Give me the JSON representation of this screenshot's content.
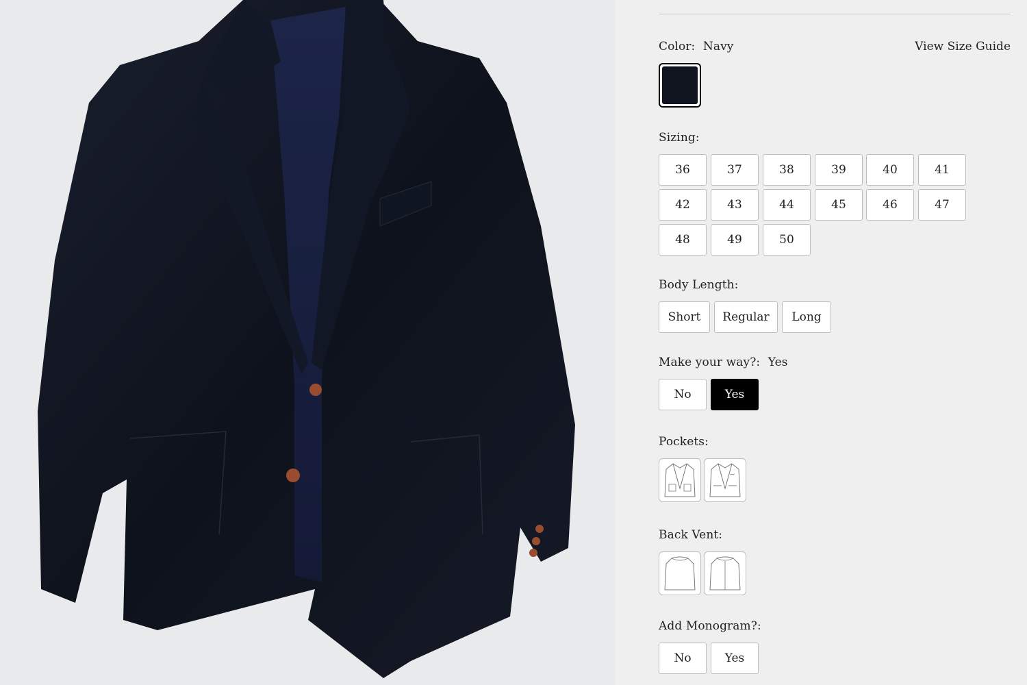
{
  "product_image": {
    "alt": "navy-sport-coat-photo"
  },
  "color": {
    "label": "Color:",
    "value": "Navy",
    "swatch_hex": "#10141e"
  },
  "size_guide": {
    "label": "View Size Guide"
  },
  "sizing": {
    "label": "Sizing:",
    "options": [
      "36",
      "37",
      "38",
      "39",
      "40",
      "41",
      "42",
      "43",
      "44",
      "45",
      "46",
      "47",
      "48",
      "49",
      "50"
    ]
  },
  "body_length": {
    "label": "Body Length:",
    "options": [
      "Short",
      "Regular",
      "Long"
    ]
  },
  "make_your_way": {
    "label": "Make your way?:",
    "value": "Yes",
    "options": [
      "No",
      "Yes"
    ],
    "selected": "Yes"
  },
  "pockets": {
    "label": "Pockets:",
    "options": [
      "patch-pockets-jacket-icon",
      "flap-pockets-jacket-icon"
    ]
  },
  "back_vent": {
    "label": "Back Vent:",
    "options": [
      "no-vent-jacket-icon",
      "center-vent-jacket-icon"
    ]
  },
  "monogram": {
    "label": "Add Monogram?:",
    "options": [
      "No",
      "Yes"
    ]
  },
  "colors": {
    "accent": "#000000",
    "panel_bg": "#efefef",
    "button_border": "#bdbdbd"
  }
}
